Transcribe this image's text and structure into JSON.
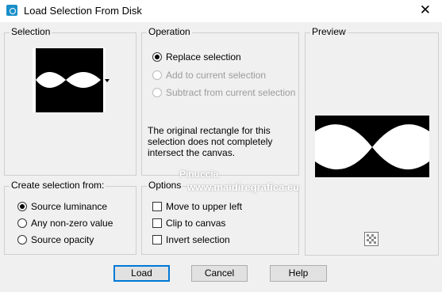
{
  "window": {
    "title": "Load Selection From Disk",
    "close_glyph": "✕"
  },
  "selection": {
    "label": "Selection"
  },
  "operation": {
    "label": "Operation",
    "options": [
      {
        "label": "Replace selection",
        "checked": true,
        "enabled": true
      },
      {
        "label": "Add to current selection",
        "checked": false,
        "enabled": false
      },
      {
        "label": "Subtract from current selection",
        "checked": false,
        "enabled": false
      }
    ],
    "note": "The original rectangle for this selection does not completely intersect the canvas."
  },
  "preview": {
    "label": "Preview"
  },
  "create_from": {
    "label": "Create selection from:",
    "options": [
      {
        "label": "Source luminance",
        "checked": true
      },
      {
        "label": "Any non-zero value",
        "checked": false
      },
      {
        "label": "Source opacity",
        "checked": false
      }
    ]
  },
  "options": {
    "label": "Options",
    "checks": [
      {
        "label": "Move to upper left",
        "checked": false
      },
      {
        "label": "Clip to canvas",
        "checked": false
      },
      {
        "label": "Invert selection",
        "checked": false
      }
    ]
  },
  "buttons": {
    "load": "Load",
    "cancel": "Cancel",
    "help": "Help"
  },
  "watermark": {
    "line1": "Pinuccia",
    "line2": "www.maidiregrafica.eu"
  },
  "icons": {
    "app": "app-icon",
    "dropdown": "dropdown-arrow-icon",
    "navigator": "navigator-icon"
  }
}
